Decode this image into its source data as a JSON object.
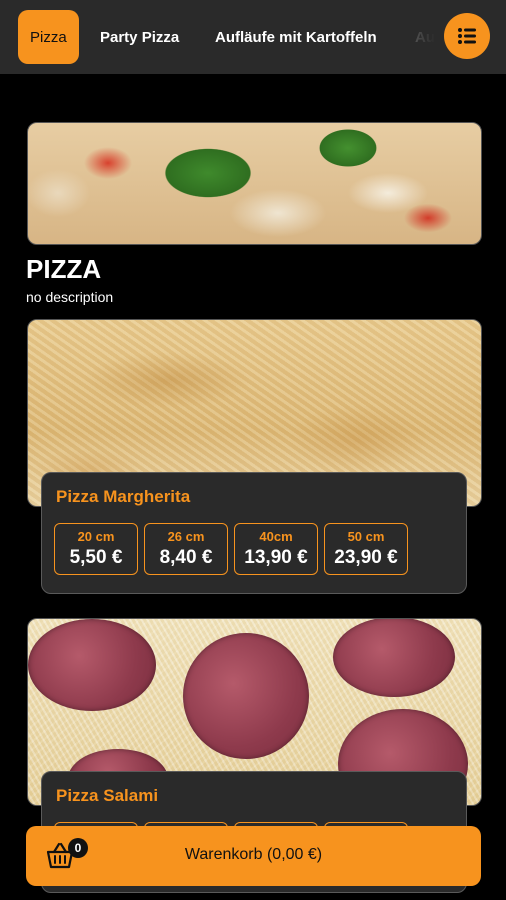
{
  "categories": [
    {
      "label": "Pizza",
      "active": true
    },
    {
      "label": "Party Pizza",
      "active": false
    },
    {
      "label": "Aufläufe mit Kartoffeln",
      "active": false
    },
    {
      "label": "Au",
      "active": false
    }
  ],
  "menu_icon": "list-icon",
  "section": {
    "title": "PIZZA",
    "description": "no description"
  },
  "products": [
    {
      "name": "Pizza Margherita",
      "sizes": [
        {
          "size": "20 cm",
          "price": "5,50 €"
        },
        {
          "size": "26 cm",
          "price": "8,40 €"
        },
        {
          "size": "40cm",
          "price": "13,90 €"
        },
        {
          "size": "50 cm",
          "price": "23,90 €"
        }
      ]
    },
    {
      "name": "Pizza Salami"
    }
  ],
  "cart": {
    "label": "Warenkorb (0,00 €)",
    "count": "0",
    "icon": "basket-icon"
  },
  "colors": {
    "accent": "#f7931e",
    "background": "#000000",
    "card": "#2a2a2a"
  }
}
